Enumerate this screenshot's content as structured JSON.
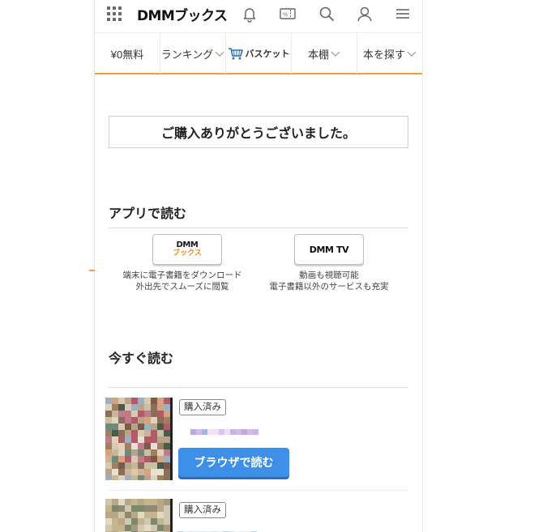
{
  "header": {
    "logo": "DMMブックス",
    "icons": [
      "grid-menu-icon",
      "bell-icon",
      "coupon-icon",
      "search-icon",
      "user-icon",
      "hamburger-icon"
    ]
  },
  "nav": {
    "items": [
      {
        "label": "¥0無料"
      },
      {
        "label": "ランキング"
      },
      {
        "label": "バスケット"
      },
      {
        "label": "本棚"
      },
      {
        "label": "本を探す"
      }
    ]
  },
  "thanks": "ご購入ありがとうございました。",
  "app_section": {
    "title": "アプリで読む",
    "apps": [
      {
        "logo_line1": "DMM",
        "logo_line2": "ブックス",
        "desc1": "端末に電子書籍をダウンロード",
        "desc2": "外出先でスムーズに閲覧"
      },
      {
        "logo": "DMM TV",
        "desc1": "動画も視聴可能",
        "desc2": "電子書籍以外のサービスも充実"
      }
    ]
  },
  "read_section": {
    "title": "今すぐ読む",
    "items": [
      {
        "badge": "購入済み",
        "button": "ブラウザで読む"
      },
      {
        "badge": "購入済み"
      }
    ]
  },
  "colors": {
    "accent": "#f29a3e",
    "button": "#3d8fe8"
  }
}
